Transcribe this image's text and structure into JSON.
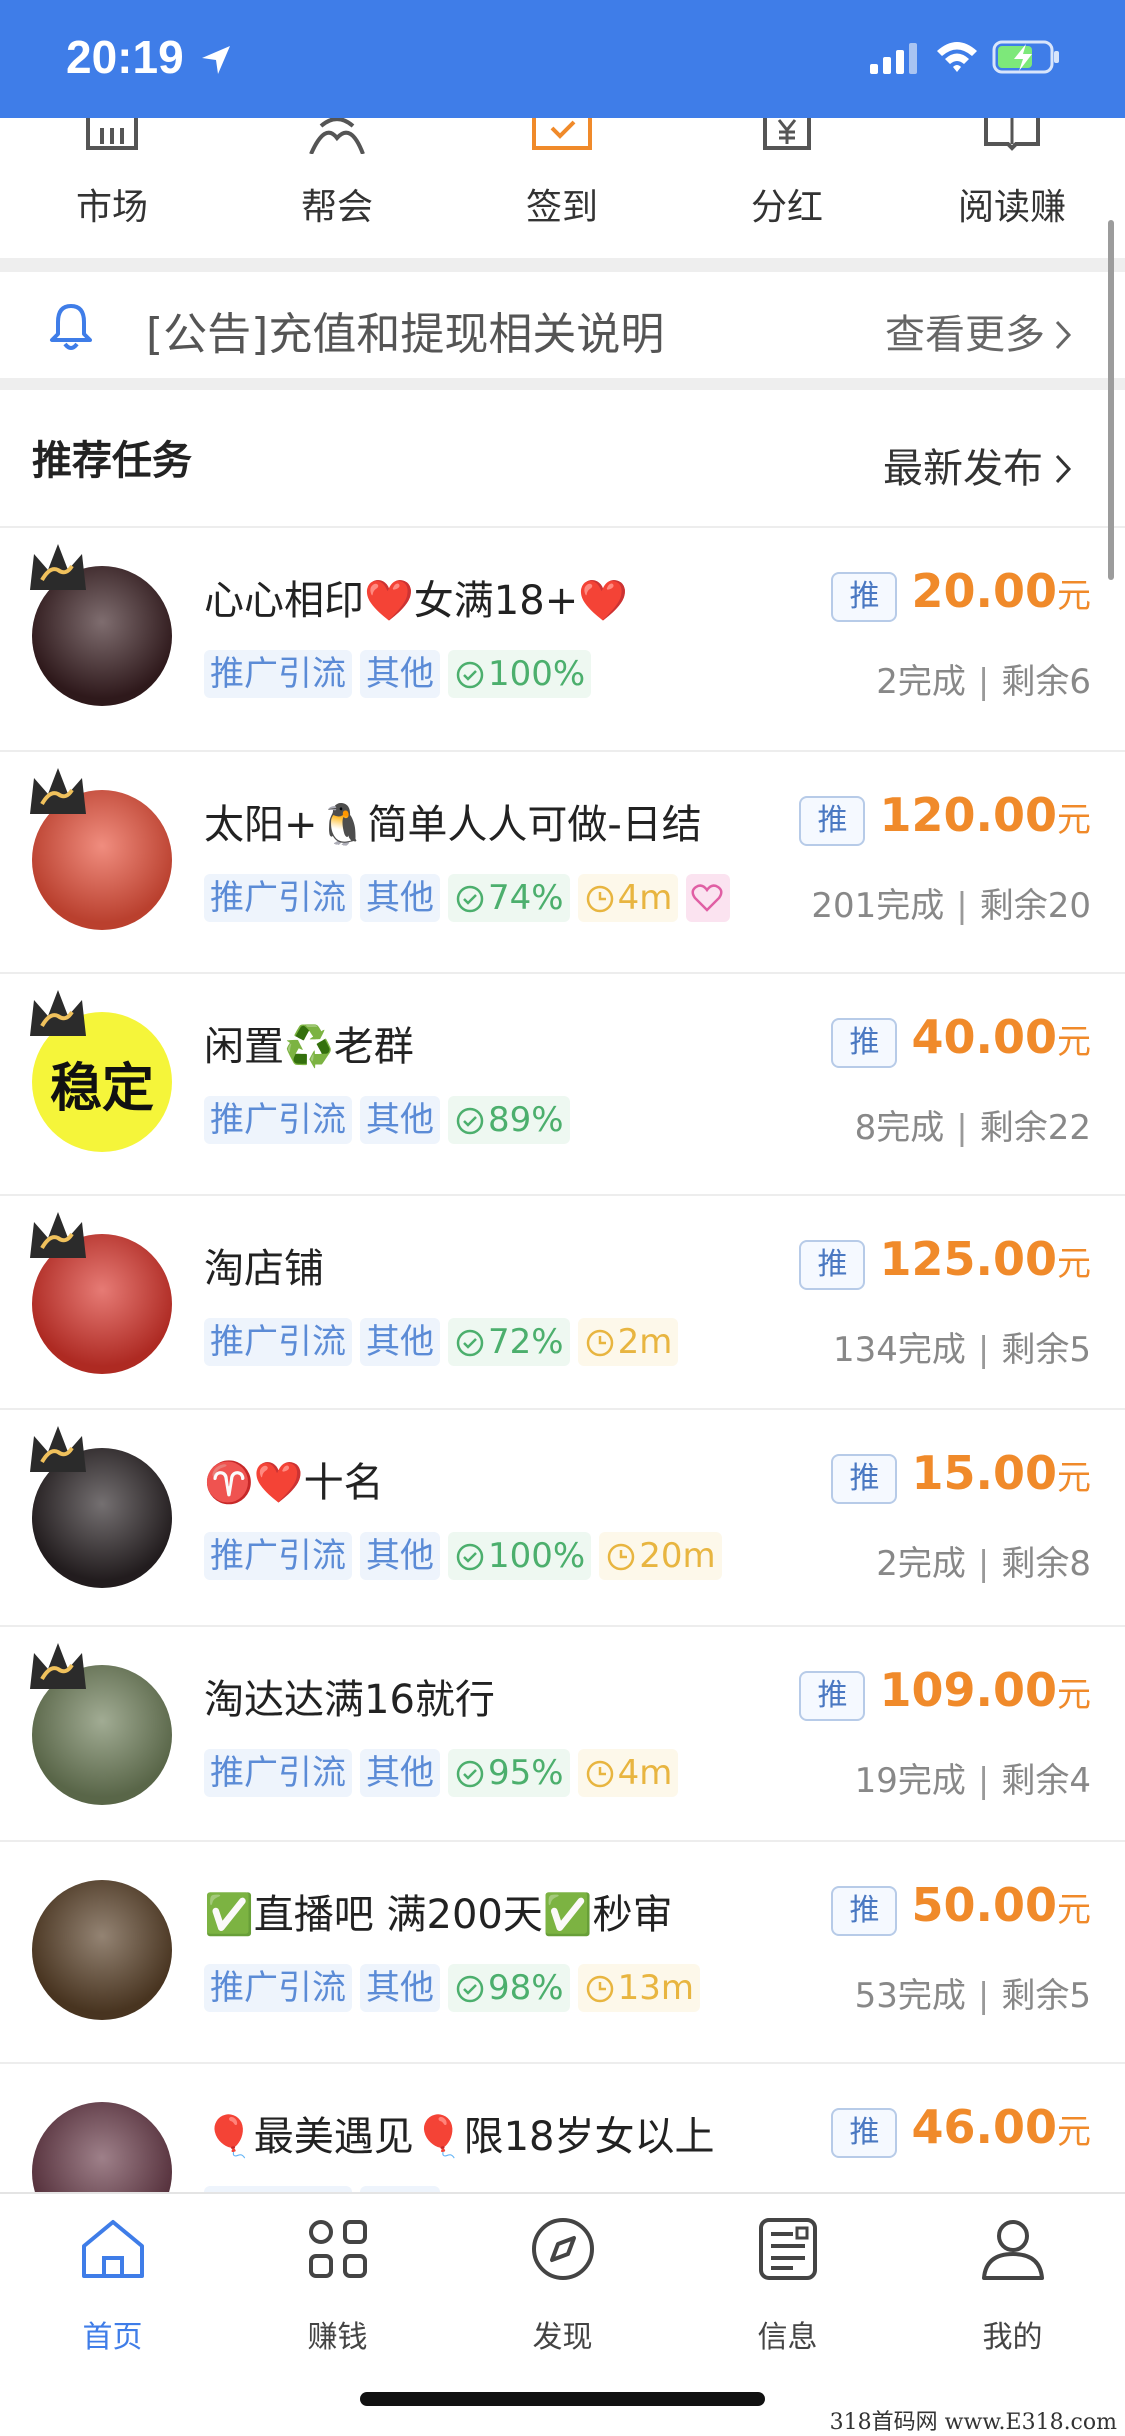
{
  "status_bar": {
    "time": "20:19"
  },
  "menu": [
    {
      "label": "市场",
      "icon": "market-icon"
    },
    {
      "label": "帮会",
      "icon": "guild-icon"
    },
    {
      "label": "签到",
      "icon": "checkin-icon"
    },
    {
      "label": "分红",
      "icon": "dividend-icon"
    },
    {
      "label": "阅读赚",
      "icon": "read-earn-icon"
    }
  ],
  "notice": {
    "text": "[公告]充值和提现相关说明",
    "more": "查看更多"
  },
  "section": {
    "title": "推荐任务",
    "more": "最新发布"
  },
  "tag_labels": {
    "promo": "推广引流",
    "other": "其他"
  },
  "badge_label": "推",
  "currency_unit": "元",
  "tasks": [
    {
      "title": "心心相印❤️女满18+❤️",
      "success": "100%",
      "time": "",
      "price": "20.00",
      "done": "2完成",
      "remain": "剩余6",
      "avatar_color": "#3a1f22",
      "heart": false
    },
    {
      "title": "太阳+🐧简单人人可做-日结",
      "success": "74%",
      "time": "4m",
      "price": "120.00",
      "done": "201完成",
      "remain": "剩余20",
      "avatar_color": "#e8503a",
      "heart": true
    },
    {
      "title": "闲置♻️老群",
      "success": "89%",
      "time": "",
      "price": "40.00",
      "done": "8完成",
      "remain": "剩余22",
      "avatar_color": "#f5f53a",
      "avatar_text": "稳定",
      "heart": false
    },
    {
      "title": "淘店铺",
      "success": "72%",
      "time": "2m",
      "price": "125.00",
      "done": "134完成",
      "remain": "剩余5",
      "avatar_color": "#d9342b",
      "heart": false
    },
    {
      "title": "♈️❤️十名",
      "success": "100%",
      "time": "20m",
      "price": "15.00",
      "done": "2完成",
      "remain": "剩余8",
      "avatar_color": "#2a2325",
      "heart": false
    },
    {
      "title": "淘达达满16就行",
      "success": "95%",
      "time": "4m",
      "price": "109.00",
      "done": "19完成",
      "remain": "剩余4",
      "avatar_color": "#6f7f5a",
      "heart": false
    },
    {
      "title": "✅直播吧 满200天✅秒审",
      "success": "98%",
      "time": "13m",
      "price": "50.00",
      "done": "53完成",
      "remain": "剩余5",
      "avatar_color": "#5a4128",
      "heart": false
    },
    {
      "title": "🎈最美遇见🎈限18岁女以上",
      "success": "",
      "time": "",
      "price": "46.00",
      "done": "",
      "remain": "",
      "avatar_color": "#6a3c4a",
      "heart": false
    }
  ],
  "bottom_nav": [
    {
      "label": "首页",
      "icon": "home-icon",
      "active": true
    },
    {
      "label": "赚钱",
      "icon": "earn-grid-icon",
      "active": false
    },
    {
      "label": "发现",
      "icon": "compass-icon",
      "active": false
    },
    {
      "label": "信息",
      "icon": "news-icon",
      "active": false
    },
    {
      "label": "我的",
      "icon": "profile-icon",
      "active": false
    }
  ],
  "watermark": "318首码网 www.E318.com",
  "colors": {
    "accent": "#3f7de8",
    "price": "#f08a2a",
    "success": "#4caf6d",
    "time": "#e8b540"
  }
}
